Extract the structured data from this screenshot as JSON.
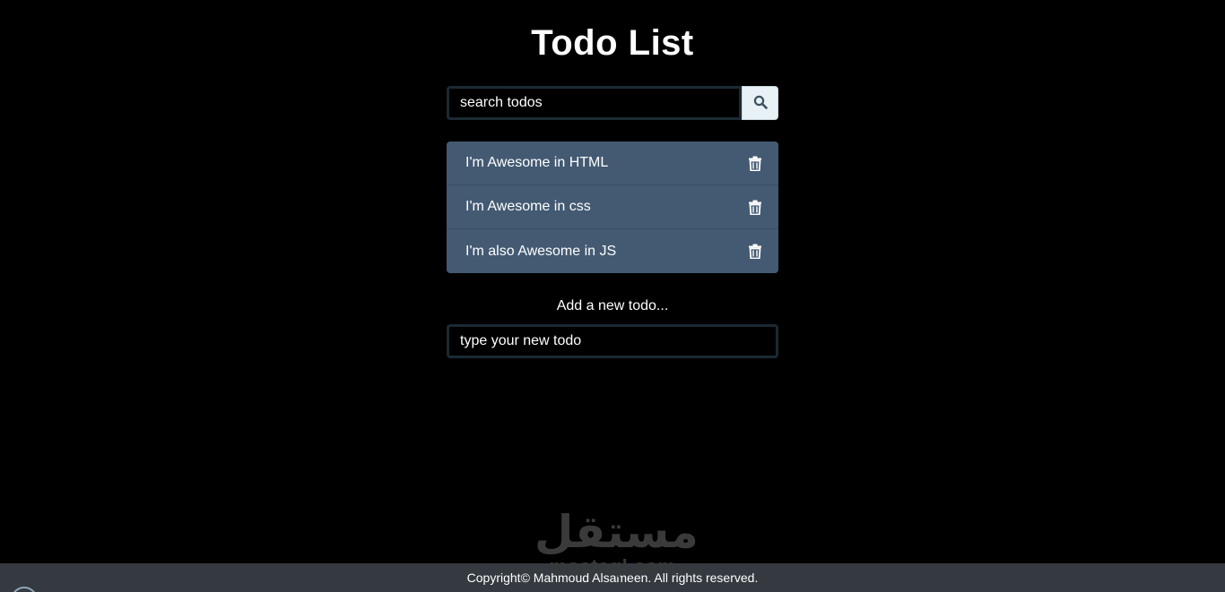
{
  "header": {
    "title": "Todo List"
  },
  "search": {
    "placeholder": "search todos",
    "button_icon": "search-icon"
  },
  "todos": [
    {
      "text": "I'm Awesome in HTML",
      "icon": "trash-icon"
    },
    {
      "text": "I'm Awesome in css",
      "icon": "trash-icon"
    },
    {
      "text": "I'm also Awesome in JS",
      "icon": "trash-icon"
    }
  ],
  "add_form": {
    "label": "Add a new todo...",
    "placeholder": "type your new todo"
  },
  "watermark": {
    "arabic": "مستقل",
    "latin": "mostaql.com"
  },
  "footer": {
    "copyright": "Copyright© Mahmoud Alsameen. All rights reserved."
  },
  "colors": {
    "background": "#000000",
    "list_background": "#435a72",
    "footer_background": "#343a40",
    "search_button": "#e8f1f5"
  }
}
